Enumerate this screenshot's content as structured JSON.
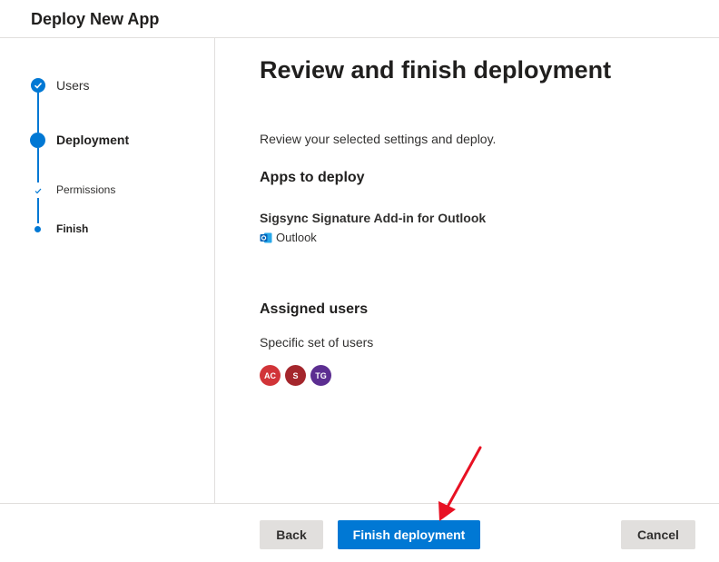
{
  "header": {
    "title": "Deploy New App"
  },
  "stepper": {
    "steps": [
      {
        "label": "Users",
        "state": "completed"
      },
      {
        "label": "Deployment",
        "state": "current"
      },
      {
        "label": "Permissions",
        "state": "completed-substep"
      },
      {
        "label": "Finish",
        "state": "current-substep"
      }
    ]
  },
  "main": {
    "title": "Review and finish deployment",
    "intro": "Review your selected settings and deploy.",
    "apps_heading": "Apps to deploy",
    "app_name": "Sigsync Signature Add-in for Outlook",
    "app_host": "Outlook",
    "assigned_heading": "Assigned users",
    "assigned_desc": "Specific set of users",
    "avatars": [
      {
        "initials": "AC",
        "color": "#d13438"
      },
      {
        "initials": "S",
        "color": "#a4262c"
      },
      {
        "initials": "TG",
        "color": "#5c2e91"
      }
    ]
  },
  "footer": {
    "back_label": "Back",
    "finish_label": "Finish deployment",
    "cancel_label": "Cancel"
  },
  "colors": {
    "accent": "#0078d4",
    "annotation_arrow": "#e81123"
  }
}
